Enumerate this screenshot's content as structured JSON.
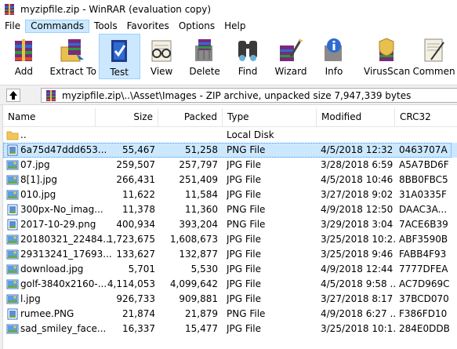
{
  "window": {
    "title": "myzipfile.zip - WinRAR (evaluation copy)"
  },
  "menu": [
    "File",
    "Commands",
    "Tools",
    "Favorites",
    "Options",
    "Help"
  ],
  "toolbar": [
    {
      "label": "Add",
      "icon": "add-archive-icon"
    },
    {
      "label": "Extract To",
      "icon": "extract-to-icon"
    },
    {
      "label": "Test",
      "icon": "test-icon"
    },
    {
      "label": "View",
      "icon": "view-icon"
    },
    {
      "label": "Delete",
      "icon": "delete-icon"
    },
    {
      "label": "Find",
      "icon": "find-icon"
    },
    {
      "label": "Wizard",
      "icon": "wizard-icon"
    },
    {
      "label": "Info",
      "icon": "info-icon"
    },
    {
      "label": "VirusScan",
      "icon": "virusscan-icon"
    },
    {
      "label": "Commen",
      "icon": "comment-icon"
    }
  ],
  "address": {
    "path": "myzipfile.zip\\..\\Asset\\Images - ZIP archive, unpacked size 7,947,339 bytes"
  },
  "columns": {
    "name": "Name",
    "size": "Size",
    "packed": "Packed",
    "type": "Type",
    "modified": "Modified",
    "crc": "CRC32"
  },
  "files": [
    {
      "name": "..",
      "size": "",
      "packed": "",
      "type": "Local Disk",
      "modified": "",
      "crc": "",
      "icon": "folder-icon"
    },
    {
      "name": "6a75d47ddd653...",
      "size": "55,467",
      "packed": "51,258",
      "type": "PNG File",
      "modified": "4/5/2018 12:32 ...",
      "crc": "0463707A",
      "icon": "png-file-icon",
      "selected": true
    },
    {
      "name": "07.jpg",
      "size": "259,507",
      "packed": "257,797",
      "type": "JPG File",
      "modified": "3/28/2018 6:59 ...",
      "crc": "A5A7BD6F",
      "icon": "jpg-file-icon"
    },
    {
      "name": "8[1].jpg",
      "size": "266,431",
      "packed": "251,409",
      "type": "JPG File",
      "modified": "4/5/2018 10:46 ...",
      "crc": "8BB0FBC5",
      "icon": "jpg-file-icon"
    },
    {
      "name": "010.jpg",
      "size": "11,622",
      "packed": "11,584",
      "type": "JPG File",
      "modified": "3/27/2018 9:02 ...",
      "crc": "31A0335F",
      "icon": "jpg-file-icon"
    },
    {
      "name": "300px-No_imag...",
      "size": "11,378",
      "packed": "11,360",
      "type": "PNG File",
      "modified": "4/9/2018 12:50 ...",
      "crc": "DAAC3A...",
      "icon": "png-file-icon"
    },
    {
      "name": "2017-10-29.png",
      "size": "400,934",
      "packed": "393,204",
      "type": "PNG File",
      "modified": "3/29/2018 3:04 ...",
      "crc": "7ACE6B39",
      "icon": "png-file-icon"
    },
    {
      "name": "20180321_22484...",
      "size": "1,723,675",
      "packed": "1,608,673",
      "type": "JPG File",
      "modified": "3/25/2018 10:2...",
      "crc": "ABF3590B",
      "icon": "jpg-file-icon"
    },
    {
      "name": "29313241_17693...",
      "size": "133,627",
      "packed": "132,877",
      "type": "JPG File",
      "modified": "3/25/2018 9:46 ...",
      "crc": "FABB4F93",
      "icon": "jpg-file-icon"
    },
    {
      "name": "download.jpg",
      "size": "5,701",
      "packed": "5,530",
      "type": "JPG File",
      "modified": "4/9/2018 12:44 ...",
      "crc": "7777DFEA",
      "icon": "jpg-file-icon"
    },
    {
      "name": "golf-3840x2160-...",
      "size": "4,114,053",
      "packed": "4,099,642",
      "type": "JPG File",
      "modified": "4/5/2018 9:58 ...",
      "crc": "AC7D969C",
      "icon": "jpg-file-icon"
    },
    {
      "name": "l.jpg",
      "size": "926,733",
      "packed": "909,881",
      "type": "JPG File",
      "modified": "3/27/2018 8:17 ...",
      "crc": "37BCD070",
      "icon": "jpg-file-icon"
    },
    {
      "name": "rumee.PNG",
      "size": "21,874",
      "packed": "21,879",
      "type": "PNG File",
      "modified": "4/9/2018 6:27 ...",
      "crc": "F386FD10",
      "icon": "png-file-icon"
    },
    {
      "name": "sad_smiley_face...",
      "size": "16,337",
      "packed": "15,477",
      "type": "JPG File",
      "modified": "3/25/2018 10:1...",
      "crc": "284E0DDB",
      "icon": "jpg-file-icon"
    }
  ]
}
